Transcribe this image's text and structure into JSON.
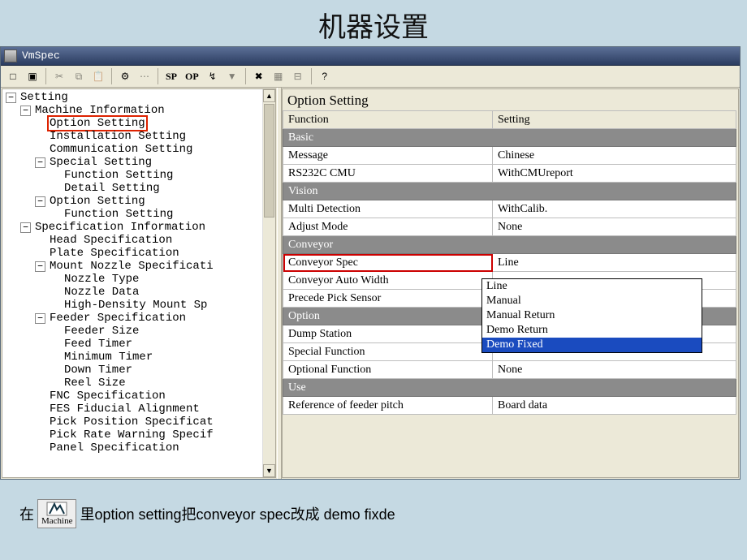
{
  "slide_title": "机器设置",
  "window": {
    "title": "VmSpec"
  },
  "toolbar": [
    {
      "name": "new-icon",
      "glyph": "□",
      "interact": true
    },
    {
      "name": "save-icon",
      "glyph": "▣",
      "interact": true
    },
    {
      "name": "sep"
    },
    {
      "name": "cut-icon",
      "glyph": "✂",
      "interact": false,
      "disabled": true
    },
    {
      "name": "copy-icon",
      "glyph": "⧉",
      "interact": false,
      "disabled": true
    },
    {
      "name": "paste-icon",
      "glyph": "📋",
      "interact": false,
      "disabled": true
    },
    {
      "name": "sep"
    },
    {
      "name": "gear-icon",
      "glyph": "⚙",
      "interact": true
    },
    {
      "name": "grid-icon",
      "glyph": "⋯",
      "interact": false,
      "disabled": true
    },
    {
      "name": "sep"
    },
    {
      "name": "sp-button",
      "text": "SP",
      "interact": true
    },
    {
      "name": "op-button",
      "text": "OP",
      "interact": true
    },
    {
      "name": "transfer-icon",
      "glyph": "↯",
      "interact": true
    },
    {
      "name": "filter-icon",
      "glyph": "▼",
      "interact": false,
      "disabled": true
    },
    {
      "name": "sep"
    },
    {
      "name": "plug-error-icon",
      "glyph": "✖",
      "interact": true
    },
    {
      "name": "chip-icon",
      "glyph": "▦",
      "interact": false,
      "disabled": true
    },
    {
      "name": "slot-icon",
      "glyph": "⊟",
      "interact": false,
      "disabled": true
    },
    {
      "name": "sep"
    },
    {
      "name": "help-icon",
      "glyph": "?",
      "interact": true
    }
  ],
  "tree": {
    "root": "Setting",
    "nodes": [
      {
        "id": "machine_info",
        "label": "Machine Information",
        "exp": true,
        "children": [
          {
            "id": "option_setting",
            "label": "Option Setting",
            "selected": true
          },
          {
            "id": "installation_setting",
            "label": "Installation Setting"
          },
          {
            "id": "communication_setting",
            "label": "Communication Setting"
          },
          {
            "id": "special_setting",
            "label": "Special Setting",
            "exp": true,
            "children": [
              {
                "id": "function_setting1",
                "label": "Function Setting"
              },
              {
                "id": "detail_setting",
                "label": "Detail Setting"
              }
            ]
          },
          {
            "id": "option_setting2",
            "label": "Option Setting",
            "exp": true,
            "children": [
              {
                "id": "function_setting2",
                "label": "Function Setting"
              }
            ]
          }
        ]
      },
      {
        "id": "spec_info",
        "label": "Specification Information",
        "exp": true,
        "children": [
          {
            "id": "head_spec",
            "label": "Head Specification"
          },
          {
            "id": "plate_spec",
            "label": "Plate Specification"
          },
          {
            "id": "mount_nozzle",
            "label": "Mount Nozzle Specificati",
            "exp": true,
            "children": [
              {
                "id": "nozzle_type",
                "label": "Nozzle Type"
              },
              {
                "id": "nozzle_data",
                "label": "Nozzle Data"
              },
              {
                "id": "high_density",
                "label": "High-Density Mount Sp"
              }
            ]
          },
          {
            "id": "feeder_spec",
            "label": "Feeder Specification",
            "exp": true,
            "children": [
              {
                "id": "feeder_size",
                "label": "Feeder Size"
              },
              {
                "id": "feed_timer",
                "label": "Feed Timer"
              },
              {
                "id": "minimum_timer",
                "label": "Minimum Timer"
              },
              {
                "id": "down_timer",
                "label": "Down Timer"
              },
              {
                "id": "reel_size",
                "label": "Reel Size"
              }
            ]
          },
          {
            "id": "fnc_spec",
            "label": "FNC Specification"
          },
          {
            "id": "fes_fiducial",
            "label": "FES Fiducial Alignment"
          },
          {
            "id": "pick_pos",
            "label": "Pick Position Specificat"
          },
          {
            "id": "pick_rate",
            "label": "Pick Rate Warning Specif"
          },
          {
            "id": "panel_spec",
            "label": "Panel Specification"
          }
        ]
      }
    ]
  },
  "grid": {
    "title": "Option Setting",
    "headers": {
      "function": "Function",
      "setting": "Setting"
    },
    "rows": [
      {
        "type": "section",
        "label": "Basic"
      },
      {
        "type": "row",
        "label": "Message",
        "value": "Chinese"
      },
      {
        "type": "row",
        "label": "RS232C CMU",
        "value": "WithCMUreport"
      },
      {
        "type": "section",
        "label": "Vision"
      },
      {
        "type": "row",
        "label": "Multi Detection",
        "value": "WithCalib."
      },
      {
        "type": "row",
        "label": "Adjust Mode",
        "value": "None"
      },
      {
        "type": "section",
        "label": "Conveyor"
      },
      {
        "type": "row",
        "label": "Conveyor Spec",
        "value": "Line",
        "highlight": true
      },
      {
        "type": "row",
        "label": "Conveyor Auto Width",
        "value": ""
      },
      {
        "type": "row",
        "label": "Precede Pick Sensor",
        "value": ""
      },
      {
        "type": "section",
        "label": "Option"
      },
      {
        "type": "row",
        "label": "Dump Station",
        "value": ""
      },
      {
        "type": "row",
        "label": "Special Function",
        "value": ""
      },
      {
        "type": "row",
        "label": "Optional Function",
        "value": "None"
      },
      {
        "type": "section",
        "label": "Use"
      },
      {
        "type": "row",
        "label": "Reference of feeder pitch",
        "value": "Board data"
      }
    ],
    "dropdown": {
      "options": [
        "Line",
        "Manual",
        "Manual Return",
        "Demo Return",
        "Demo Fixed"
      ],
      "highlighted": "Demo Fixed"
    }
  },
  "footer": {
    "pre": "在",
    "machine_label": "Machine",
    "post": "里option setting把conveyor spec改成 demo fixde"
  }
}
